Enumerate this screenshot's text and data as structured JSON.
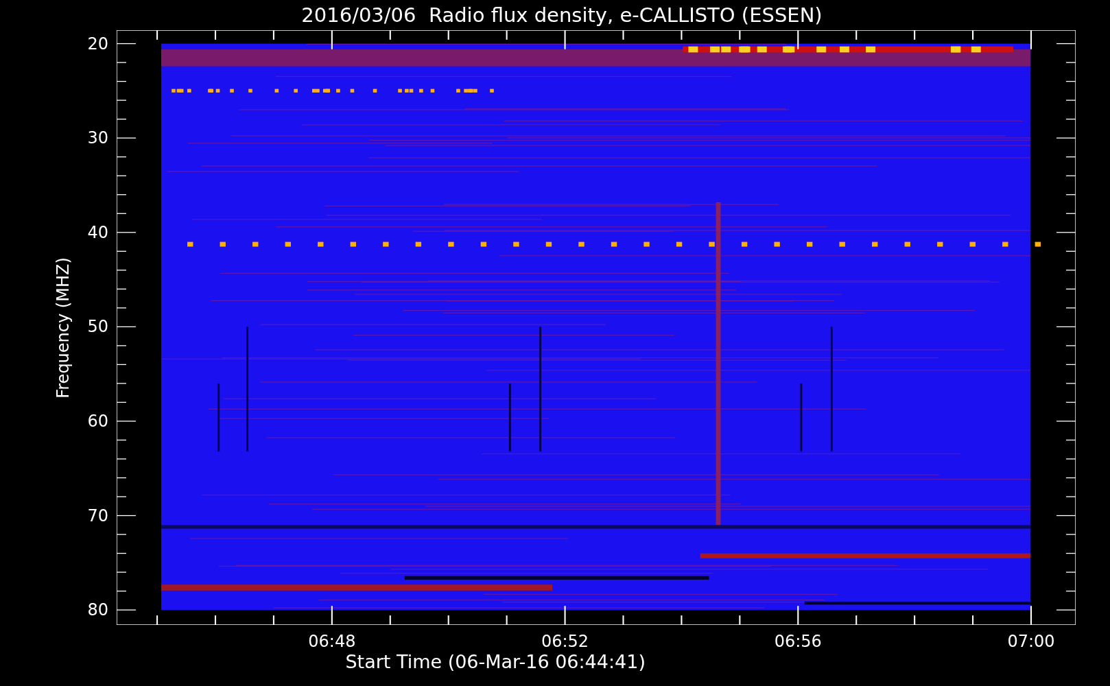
{
  "title": "2016/03/06  Radio flux density, e-CALLISTO (ESSEN)",
  "ylabel": "Frequency (MHZ)",
  "xlabel": "Start Time (06-Mar-16 06:44:41)",
  "yticks": [
    "20",
    "30",
    "40",
    "50",
    "60",
    "70",
    "80"
  ],
  "xticks": [
    "06:48",
    "06:52",
    "06:56",
    "07:00"
  ]
}
